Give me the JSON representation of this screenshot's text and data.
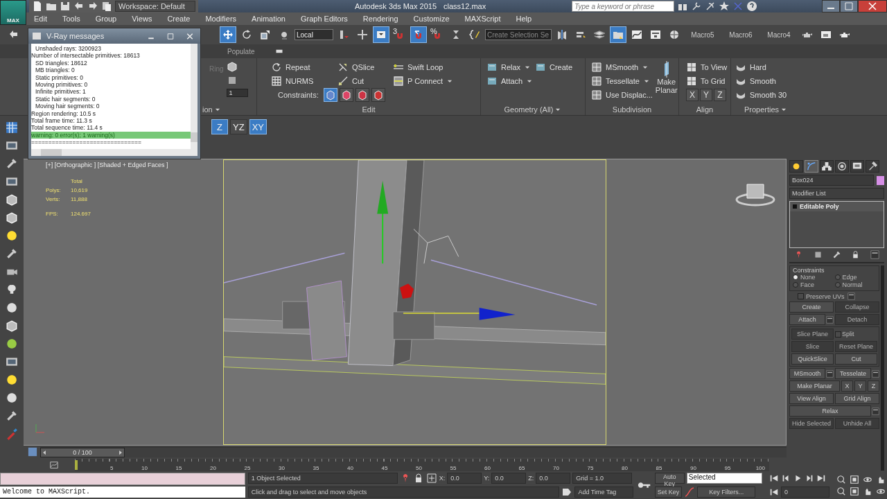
{
  "title_bar": {
    "app_label": "MAX",
    "workspace": "Workspace: Default",
    "title": "Autodesk 3ds Max  2015",
    "file": "class12.max",
    "search": {
      "placeholder": "Type a keyword or phrase"
    }
  },
  "menu": [
    "Edit",
    "Tools",
    "Group",
    "Views",
    "Create",
    "Modifiers",
    "Animation",
    "Graph Editors",
    "Rendering",
    "Customize",
    "MAXScript",
    "Help"
  ],
  "main_toolbar": [
    {
      "kind": "undo",
      "selected": false
    },
    {
      "kind": "move",
      "selected": true
    },
    {
      "kind": "rotate",
      "selected": false
    },
    {
      "kind": "scale",
      "selected": false
    },
    {
      "kind": "placement",
      "selected": false
    },
    {
      "kind": "dropdown",
      "label": "Local",
      "selected": false
    },
    {
      "kind": "pivot",
      "selected": false
    },
    {
      "kind": "manipulate",
      "selected": false
    },
    {
      "kind": "keyboard",
      "selected": true
    },
    {
      "kind": "snap",
      "label": "3",
      "selected": false
    },
    {
      "kind": "angle-snap",
      "selected": true
    },
    {
      "kind": "percent-snap",
      "label": "%",
      "selected": false
    },
    {
      "kind": "spinner-snap",
      "selected": false
    },
    {
      "kind": "named-selection",
      "selected": false
    },
    {
      "kind": "dropdown",
      "label": "Create Selection Se",
      "selected": false
    },
    {
      "kind": "mirror",
      "selected": false
    },
    {
      "kind": "align",
      "selected": false
    },
    {
      "kind": "layers",
      "selected": false
    },
    {
      "kind": "explorer",
      "selected": true
    },
    {
      "kind": "curve-editor",
      "selected": false
    },
    {
      "kind": "schematic",
      "selected": false
    },
    {
      "kind": "material",
      "selected": false
    },
    {
      "kind": "macro",
      "label": "Macro5",
      "selected": false
    },
    {
      "kind": "macro",
      "label": "Macro6",
      "selected": false
    },
    {
      "kind": "macro",
      "label": "Macro4",
      "selected": false
    },
    {
      "kind": "render-setup",
      "selected": false
    },
    {
      "kind": "frame-window",
      "selected": false
    },
    {
      "kind": "render",
      "selected": false
    }
  ],
  "ribbon": {
    "populate_tab": "Populate",
    "partial_group": {
      "label": "ion",
      "ring": "Ring",
      "spinner": "1"
    },
    "edit": {
      "label": "Edit",
      "items": [
        {
          "label": "Repeat",
          "kind": "repeat",
          "dropdown": false
        },
        {
          "label": "QSlice",
          "kind": "qslice",
          "dropdown": false
        },
        {
          "label": "Swift Loop",
          "kind": "swift-loop",
          "dropdown": false
        },
        {
          "label": "NURMS",
          "kind": "nurms",
          "dropdown": false
        },
        {
          "label": "Cut",
          "kind": "cut",
          "dropdown": false
        },
        {
          "label": "P Connect",
          "kind": "connect",
          "dropdown": true
        }
      ],
      "constraints": {
        "label": "Constraints:",
        "options": [
          {
            "selected": true
          },
          {
            "selected": false
          },
          {
            "selected": false
          },
          {
            "selected": false
          }
        ]
      }
    },
    "geometry": {
      "label": "Geometry (All)",
      "items": [
        {
          "label": "Relax",
          "dropdown": true
        },
        {
          "label": "Create",
          "dropdown": false
        },
        {
          "label": "Attach",
          "dropdown": true
        }
      ]
    },
    "subdivision": {
      "label": "Subdivision",
      "items": [
        {
          "label": "MSmooth",
          "dropdown": true
        },
        {
          "label": "Tessellate",
          "dropdown": true
        },
        {
          "label": "Use Displac...",
          "dropdown": false
        }
      ],
      "large": "Make Planar"
    },
    "align": {
      "label": "Align",
      "items": [
        "To View",
        "To Grid"
      ],
      "axes": [
        "X",
        "Y",
        "Z"
      ]
    },
    "properties": {
      "label": "Properties",
      "items": [
        "Hard",
        "Smooth",
        "Smooth 30"
      ]
    }
  },
  "axis_constraints": [
    {
      "label": "Z",
      "selected": true
    },
    {
      "label": "YZ",
      "selected": false
    },
    {
      "label": "XY",
      "selected": true
    }
  ],
  "vray_window": {
    "title": "V-Ray messages",
    "lines": [
      {
        "text": "Unshaded rays: 3200923",
        "indented": true,
        "selected": false
      },
      {
        "text": "Number of intersectable primitives: 18613",
        "indented": false,
        "selected": false
      },
      {
        "text": "SD triangles: 18612",
        "indented": true,
        "selected": false
      },
      {
        "text": "MB triangles: 0",
        "indented": true,
        "selected": false
      },
      {
        "text": "Static primitives: 0",
        "indented": true,
        "selected": false
      },
      {
        "text": "Moving primitives: 0",
        "indented": true,
        "selected": false
      },
      {
        "text": "Infinite primitives: 1",
        "indented": true,
        "selected": false
      },
      {
        "text": "Static hair segments: 0",
        "indented": true,
        "selected": false
      },
      {
        "text": "Moving hair segments: 0",
        "indented": true,
        "selected": false
      },
      {
        "text": "Region rendering: 10.5 s",
        "indented": false,
        "selected": false
      },
      {
        "text": "Total frame time: 11.3 s",
        "indented": false,
        "selected": false
      },
      {
        "text": "Total sequence time: 11.4 s",
        "indented": false,
        "selected": false
      },
      {
        "text": "warning: 0 error(s); 1 warning(s)",
        "indented": false,
        "selected": true
      },
      {
        "text": "================================",
        "indented": false,
        "selected": false
      }
    ]
  },
  "viewport": {
    "label": "[+] [Orthographic ] [Shaded + Edged Faces ]",
    "stats_header": "Total",
    "stats": [
      {
        "label": "Polys:",
        "value": "10,619"
      },
      {
        "label": "Verts:",
        "value": "11,888"
      }
    ],
    "fps": {
      "label": "FPS:",
      "value": "124.697"
    }
  },
  "command_panel": {
    "tabs": [
      {
        "kind": "create",
        "selected": false
      },
      {
        "kind": "modify",
        "selected": true
      },
      {
        "kind": "hierarchy",
        "selected": false
      },
      {
        "kind": "motion",
        "selected": false
      },
      {
        "kind": "display",
        "selected": false
      },
      {
        "kind": "utilities",
        "selected": false
      }
    ],
    "object_name": "Box024",
    "modifier_list": "Modifier List",
    "stack": [
      {
        "label": "Editable Poly",
        "selected": true
      }
    ],
    "constraints": {
      "title": "Constraints",
      "options": [
        {
          "label": "None",
          "selected": true
        },
        {
          "label": "Edge",
          "selected": false
        },
        {
          "label": "Face",
          "selected": false
        },
        {
          "label": "Normal",
          "selected": false
        }
      ]
    },
    "preserve_uvs": {
      "label": "Preserve UVs",
      "checked": false
    },
    "sections": [
      {
        "boxed": false,
        "rows": [
          [
            {
              "kind": "button",
              "label": "Create",
              "disabled": false,
              "settings": false
            },
            {
              "kind": "button",
              "label": "Collapse",
              "disabled": true,
              "settings": false
            }
          ],
          [
            {
              "kind": "button",
              "label": "Attach",
              "disabled": false,
              "settings": true
            },
            {
              "kind": "button",
              "label": "Detach",
              "disabled": true,
              "settings": false
            }
          ]
        ]
      },
      {
        "boxed": true,
        "rows": [
          [
            {
              "kind": "button",
              "label": "Slice Plane",
              "disabled": true,
              "settings": false
            },
            {
              "kind": "checkbox",
              "label": "Split",
              "checked": false
            }
          ],
          [
            {
              "kind": "button",
              "label": "Slice",
              "disabled": true,
              "settings": false
            },
            {
              "kind": "button",
              "label": "Reset Plane",
              "disabled": true,
              "settings": false
            }
          ],
          [
            {
              "kind": "button",
              "label": "QuickSlice",
              "disabled": false,
              "settings": false
            },
            {
              "kind": "button",
              "label": "Cut",
              "disabled": false,
              "settings": false
            }
          ]
        ]
      },
      {
        "boxed": false,
        "rows": [
          [
            {
              "kind": "button",
              "label": "MSmooth",
              "disabled": false,
              "settings": true
            },
            {
              "kind": "button",
              "label": "Tesselate",
              "disabled": false,
              "settings": true
            }
          ],
          [
            {
              "kind": "button",
              "label": "Make Planar",
              "disabled": false,
              "settings": false
            },
            {
              "kind": "axis",
              "label": "X",
              "disabled": false,
              "settings": false
            },
            {
              "kind": "axis",
              "label": "Y",
              "disabled": false,
              "settings": false
            },
            {
              "kind": "axis",
              "label": "Z",
              "disabled": false,
              "settings": false
            }
          ],
          [
            {
              "kind": "button",
              "label": "View Align",
              "disabled": false,
              "settings": false
            },
            {
              "kind": "button",
              "label": "Grid Align",
              "disabled": false,
              "settings": false
            }
          ],
          [
            {
              "kind": "button",
              "label": "Relax",
              "disabled": false,
              "settings": true
            }
          ],
          [
            {
              "kind": "button",
              "label": "Hide Selected",
              "disabled": true,
              "settings": false
            },
            {
              "kind": "button",
              "label": "Unhide All",
              "disabled": true,
              "settings": false
            }
          ]
        ]
      }
    ]
  },
  "time_slider": {
    "label": "0 / 100",
    "level": 0
  },
  "track_bar": {
    "ticks": [
      "5",
      "10",
      "15",
      "20",
      "25",
      "30",
      "35",
      "40",
      "45",
      "50",
      "55",
      "60",
      "65",
      "70",
      "75",
      "80",
      "85",
      "90",
      "95",
      "100"
    ]
  },
  "status_bar": {
    "listener_output": "Welcome to MAXScript.",
    "selection": "1 Object Selected",
    "prompt": "Click and drag to select and move objects",
    "coords": [
      {
        "label": "X:",
        "value": "0.0"
      },
      {
        "label": "Y:",
        "value": "0.0"
      },
      {
        "label": "Z:",
        "value": "0.0"
      }
    ],
    "grid": "Grid = 1.0",
    "time_tag": "Add Time Tag",
    "auto_key": "Auto Key",
    "set_key": "Set Key",
    "key_mode": "Selected",
    "key_filters": "Key Filters...",
    "frame": "0"
  }
}
